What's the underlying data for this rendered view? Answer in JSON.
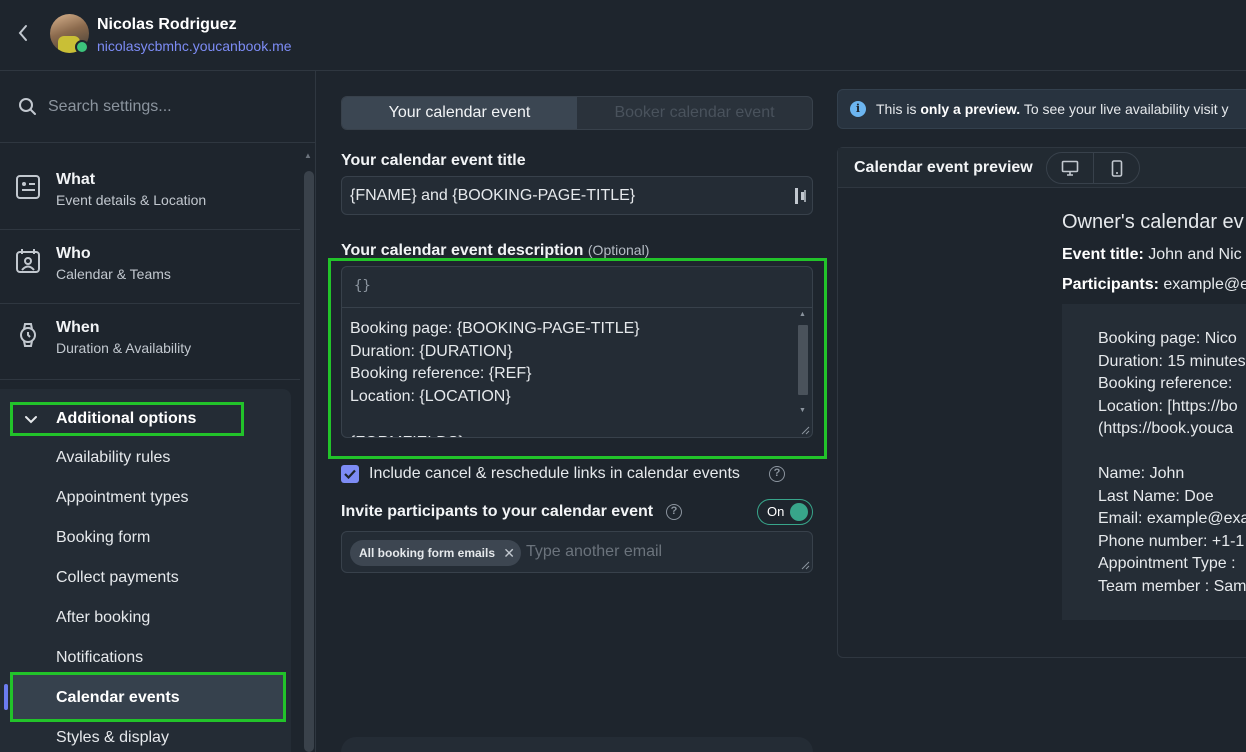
{
  "header": {
    "user_name": "Nicolas Rodriguez",
    "user_url": "nicolasycbmhc.youcanbook.me"
  },
  "sidebar": {
    "search_placeholder": "Search settings...",
    "main_items": [
      {
        "title": "What",
        "subtitle": "Event details & Location",
        "icon": "document-icon"
      },
      {
        "title": "Who",
        "subtitle": "Calendar & Teams",
        "icon": "calendar-person-icon"
      },
      {
        "title": "When",
        "subtitle": "Duration & Availability",
        "icon": "watch-icon"
      }
    ],
    "additional_options_label": "Additional options",
    "sub_items": [
      "Availability rules",
      "Appointment types",
      "Booking form",
      "Collect payments",
      "After booking",
      "Notifications",
      "Calendar events",
      "Styles & display"
    ],
    "active_item": "Calendar events"
  },
  "tabs": {
    "active": "Your calendar event",
    "inactive": "Booker calendar event"
  },
  "form": {
    "title_label": "Your calendar event title",
    "title_value": "{FNAME} and {BOOKING-PAGE-TITLE}",
    "description_label": "Your calendar event description",
    "description_optional": "(Optional)",
    "description_toolbar_icon": "{}",
    "description_value": "Booking page: {BOOKING-PAGE-TITLE}\nDuration: {DURATION}\nBooking reference: {REF}\nLocation: {LOCATION}\n\n{FORMFIELDS}",
    "include_links_label": "Include cancel & reschedule links in calendar events",
    "include_links_checked": true,
    "invite_label": "Invite participants to your calendar event",
    "invite_toggle": "On",
    "invite_chip": "All booking form emails",
    "invite_placeholder": "Type another email"
  },
  "preview": {
    "info_prefix": "This is ",
    "info_bold": "only a preview.",
    "info_suffix": " To see your live availability visit y",
    "panel_title": "Calendar event preview",
    "owner_heading": "Owner's calendar ev",
    "event_title_label": "Event title:",
    "event_title_value": " John and Nic",
    "participants_label": "Participants:",
    "participants_value": " example@e",
    "body": "Booking page: Nico\nDuration: 15 minutes\nBooking reference: \nLocation: [https://bo\n(https://book.youca\n\nName: John\nLast Name: Doe\nEmail: example@exa\nPhone number: +1-1\nAppointment Type :\nTeam member : Sam"
  },
  "colors": {
    "background": "#1e252d",
    "accent": "#7d8cf5",
    "highlight": "#22c32a",
    "toggle_on": "#38a58a"
  }
}
